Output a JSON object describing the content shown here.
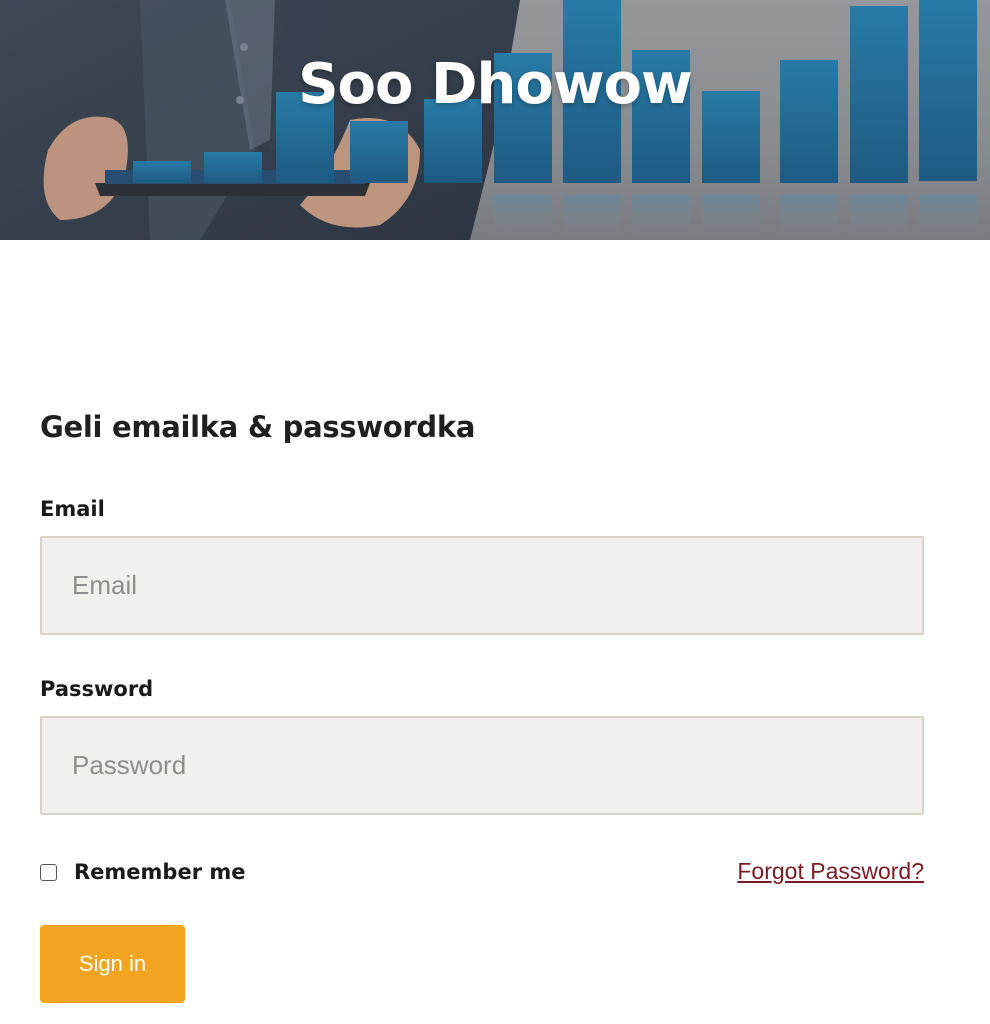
{
  "hero": {
    "title": "Soo Dhowow"
  },
  "form": {
    "heading": "Geli emailka & passwordka",
    "email_label": "Email",
    "email_placeholder": "Email",
    "email_value": "",
    "password_label": "Password",
    "password_placeholder": "Password",
    "password_value": "",
    "remember_label": "Remember me",
    "remember_checked": false,
    "forgot_link": "Forgot Password?",
    "signin_label": "Sign in"
  },
  "colors": {
    "accent_button": "#f3a521",
    "link": "#7a1a22",
    "input_bg": "#f1f0ed",
    "input_border": "#d8d3c6"
  }
}
